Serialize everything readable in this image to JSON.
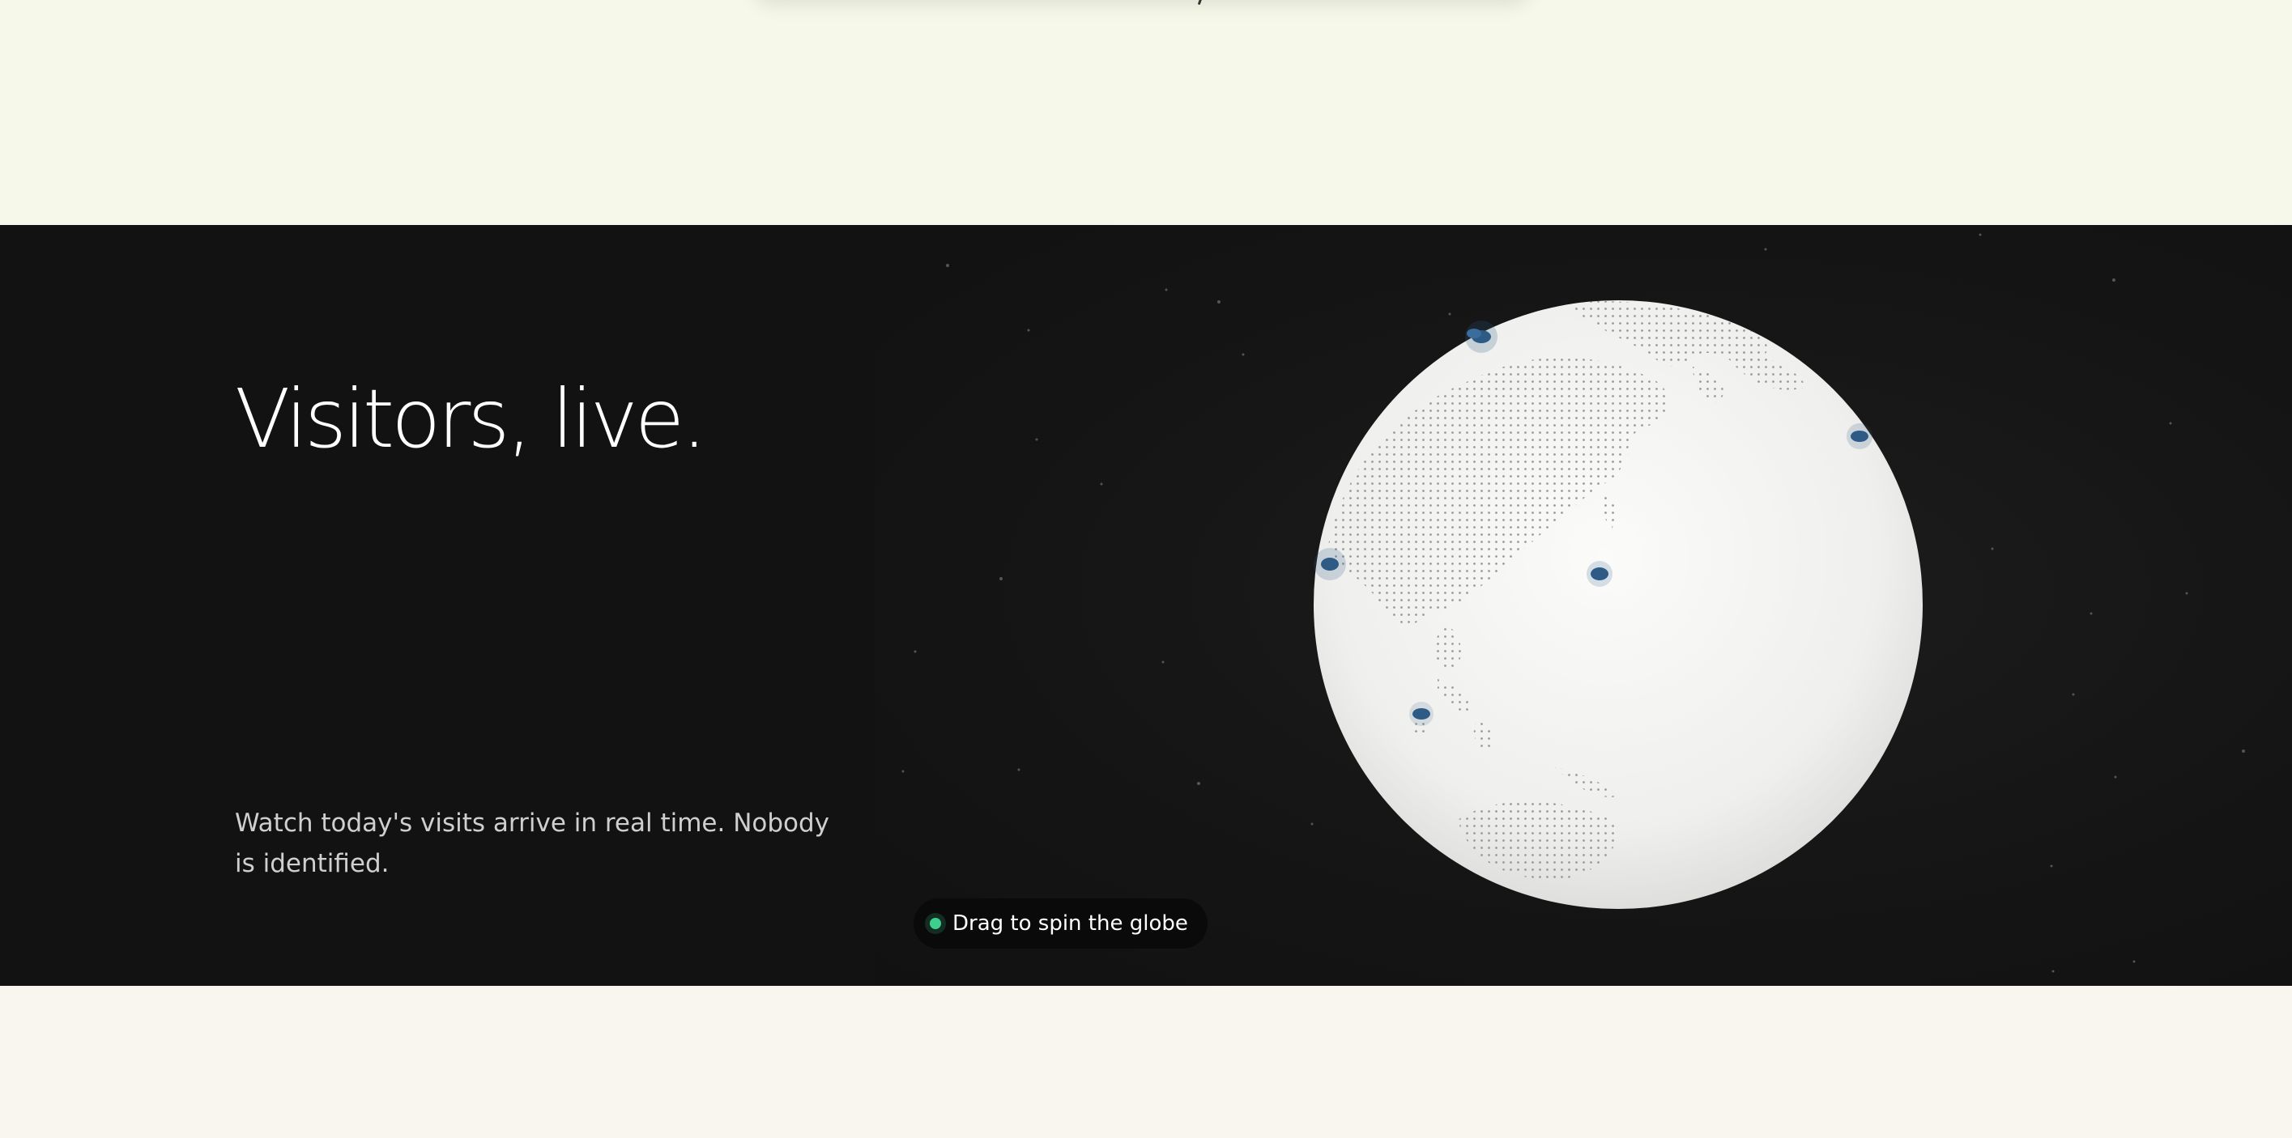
{
  "section": {
    "headline": "Visitors, live.",
    "subtitle": "Watch today's visits arrive in real time. Nobody is identified."
  },
  "globe_hint": {
    "label": "Drag to spin the globe",
    "status_icon": "green-dot-icon"
  },
  "colors": {
    "top_background": "#f6f9e9",
    "dark_background": "#141414",
    "bottom_background": "#f9f5ef",
    "globe_fill": "#f4f4f2",
    "visitor_marker": "#2d5b86",
    "status_dot": "#3ecf8e",
    "headline_text": "#ffffff",
    "subtitle_text": "#cfcfcf"
  }
}
